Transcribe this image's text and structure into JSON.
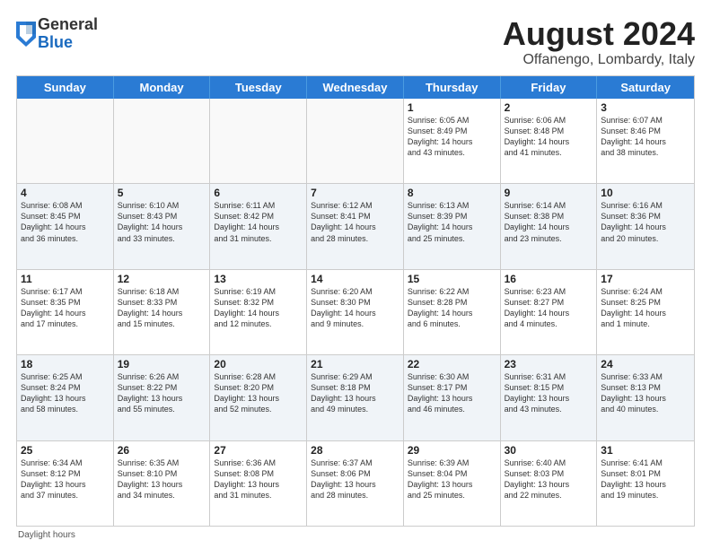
{
  "logo": {
    "general": "General",
    "blue": "Blue"
  },
  "title": {
    "month": "August 2024",
    "location": "Offanengo, Lombardy, Italy"
  },
  "calendar": {
    "headers": [
      "Sunday",
      "Monday",
      "Tuesday",
      "Wednesday",
      "Thursday",
      "Friday",
      "Saturday"
    ],
    "footer": "Daylight hours",
    "rows": [
      [
        {
          "day": "",
          "info": "",
          "empty": true
        },
        {
          "day": "",
          "info": "",
          "empty": true
        },
        {
          "day": "",
          "info": "",
          "empty": true
        },
        {
          "day": "",
          "info": "",
          "empty": true
        },
        {
          "day": "1",
          "info": "Sunrise: 6:05 AM\nSunset: 8:49 PM\nDaylight: 14 hours\nand 43 minutes."
        },
        {
          "day": "2",
          "info": "Sunrise: 6:06 AM\nSunset: 8:48 PM\nDaylight: 14 hours\nand 41 minutes."
        },
        {
          "day": "3",
          "info": "Sunrise: 6:07 AM\nSunset: 8:46 PM\nDaylight: 14 hours\nand 38 minutes."
        }
      ],
      [
        {
          "day": "4",
          "info": "Sunrise: 6:08 AM\nSunset: 8:45 PM\nDaylight: 14 hours\nand 36 minutes."
        },
        {
          "day": "5",
          "info": "Sunrise: 6:10 AM\nSunset: 8:43 PM\nDaylight: 14 hours\nand 33 minutes."
        },
        {
          "day": "6",
          "info": "Sunrise: 6:11 AM\nSunset: 8:42 PM\nDaylight: 14 hours\nand 31 minutes."
        },
        {
          "day": "7",
          "info": "Sunrise: 6:12 AM\nSunset: 8:41 PM\nDaylight: 14 hours\nand 28 minutes."
        },
        {
          "day": "8",
          "info": "Sunrise: 6:13 AM\nSunset: 8:39 PM\nDaylight: 14 hours\nand 25 minutes."
        },
        {
          "day": "9",
          "info": "Sunrise: 6:14 AM\nSunset: 8:38 PM\nDaylight: 14 hours\nand 23 minutes."
        },
        {
          "day": "10",
          "info": "Sunrise: 6:16 AM\nSunset: 8:36 PM\nDaylight: 14 hours\nand 20 minutes."
        }
      ],
      [
        {
          "day": "11",
          "info": "Sunrise: 6:17 AM\nSunset: 8:35 PM\nDaylight: 14 hours\nand 17 minutes."
        },
        {
          "day": "12",
          "info": "Sunrise: 6:18 AM\nSunset: 8:33 PM\nDaylight: 14 hours\nand 15 minutes."
        },
        {
          "day": "13",
          "info": "Sunrise: 6:19 AM\nSunset: 8:32 PM\nDaylight: 14 hours\nand 12 minutes."
        },
        {
          "day": "14",
          "info": "Sunrise: 6:20 AM\nSunset: 8:30 PM\nDaylight: 14 hours\nand 9 minutes."
        },
        {
          "day": "15",
          "info": "Sunrise: 6:22 AM\nSunset: 8:28 PM\nDaylight: 14 hours\nand 6 minutes."
        },
        {
          "day": "16",
          "info": "Sunrise: 6:23 AM\nSunset: 8:27 PM\nDaylight: 14 hours\nand 4 minutes."
        },
        {
          "day": "17",
          "info": "Sunrise: 6:24 AM\nSunset: 8:25 PM\nDaylight: 14 hours\nand 1 minute."
        }
      ],
      [
        {
          "day": "18",
          "info": "Sunrise: 6:25 AM\nSunset: 8:24 PM\nDaylight: 13 hours\nand 58 minutes."
        },
        {
          "day": "19",
          "info": "Sunrise: 6:26 AM\nSunset: 8:22 PM\nDaylight: 13 hours\nand 55 minutes."
        },
        {
          "day": "20",
          "info": "Sunrise: 6:28 AM\nSunset: 8:20 PM\nDaylight: 13 hours\nand 52 minutes."
        },
        {
          "day": "21",
          "info": "Sunrise: 6:29 AM\nSunset: 8:18 PM\nDaylight: 13 hours\nand 49 minutes."
        },
        {
          "day": "22",
          "info": "Sunrise: 6:30 AM\nSunset: 8:17 PM\nDaylight: 13 hours\nand 46 minutes."
        },
        {
          "day": "23",
          "info": "Sunrise: 6:31 AM\nSunset: 8:15 PM\nDaylight: 13 hours\nand 43 minutes."
        },
        {
          "day": "24",
          "info": "Sunrise: 6:33 AM\nSunset: 8:13 PM\nDaylight: 13 hours\nand 40 minutes."
        }
      ],
      [
        {
          "day": "25",
          "info": "Sunrise: 6:34 AM\nSunset: 8:12 PM\nDaylight: 13 hours\nand 37 minutes."
        },
        {
          "day": "26",
          "info": "Sunrise: 6:35 AM\nSunset: 8:10 PM\nDaylight: 13 hours\nand 34 minutes."
        },
        {
          "day": "27",
          "info": "Sunrise: 6:36 AM\nSunset: 8:08 PM\nDaylight: 13 hours\nand 31 minutes."
        },
        {
          "day": "28",
          "info": "Sunrise: 6:37 AM\nSunset: 8:06 PM\nDaylight: 13 hours\nand 28 minutes."
        },
        {
          "day": "29",
          "info": "Sunrise: 6:39 AM\nSunset: 8:04 PM\nDaylight: 13 hours\nand 25 minutes."
        },
        {
          "day": "30",
          "info": "Sunrise: 6:40 AM\nSunset: 8:03 PM\nDaylight: 13 hours\nand 22 minutes."
        },
        {
          "day": "31",
          "info": "Sunrise: 6:41 AM\nSunset: 8:01 PM\nDaylight: 13 hours\nand 19 minutes."
        }
      ]
    ]
  }
}
